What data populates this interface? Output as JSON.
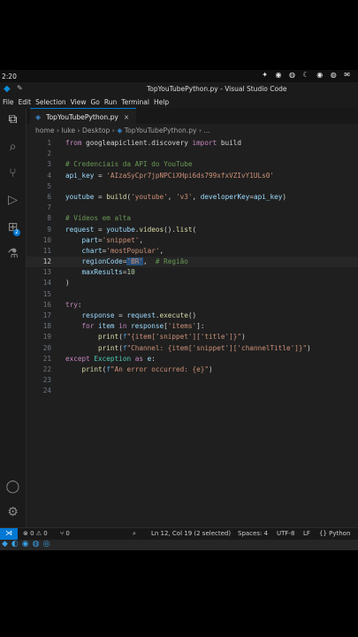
{
  "system": {
    "time": "2:20"
  },
  "window": {
    "title": "TopYouTubePython.py - Visual Studio Code"
  },
  "menu": [
    "File",
    "Edit",
    "Selection",
    "View",
    "Go",
    "Run",
    "Terminal",
    "Help"
  ],
  "tab": {
    "label": "TopYouTubePython.py",
    "close": "×"
  },
  "breadcrumb": [
    "home",
    "luke",
    "Desktop",
    "TopYouTubePython.py",
    "..."
  ],
  "code": [
    {
      "n": "1",
      "parts": [
        [
          "kw",
          "from"
        ],
        [
          "plain",
          " googleapiclient.discovery "
        ],
        [
          "kw",
          "import"
        ],
        [
          "plain",
          " build"
        ]
      ]
    },
    {
      "n": "2",
      "parts": []
    },
    {
      "n": "3",
      "parts": [
        [
          "cm",
          "# Credenciais da API do YouTube"
        ]
      ]
    },
    {
      "n": "4",
      "parts": [
        [
          "var",
          "api_key"
        ],
        [
          "plain",
          " = "
        ],
        [
          "str",
          "'AIzaSyCpr7jpNPCiXHpi6ds799xfxVZIvY1ULs0'"
        ]
      ]
    },
    {
      "n": "5",
      "parts": []
    },
    {
      "n": "6",
      "parts": [
        [
          "var",
          "youtube"
        ],
        [
          "plain",
          " = "
        ],
        [
          "fn",
          "build"
        ],
        [
          "plain",
          "("
        ],
        [
          "str",
          "'youtube'"
        ],
        [
          "plain",
          ", "
        ],
        [
          "str",
          "'v3'"
        ],
        [
          "plain",
          ", "
        ],
        [
          "var",
          "developerKey"
        ],
        [
          "plain",
          "="
        ],
        [
          "var",
          "api_key"
        ],
        [
          "plain",
          ")"
        ]
      ]
    },
    {
      "n": "7",
      "parts": []
    },
    {
      "n": "8",
      "parts": [
        [
          "cm",
          "# Vídeos em alta"
        ]
      ]
    },
    {
      "n": "9",
      "parts": [
        [
          "var",
          "request"
        ],
        [
          "plain",
          " = "
        ],
        [
          "var",
          "youtube"
        ],
        [
          "plain",
          "."
        ],
        [
          "fn",
          "videos"
        ],
        [
          "plain",
          "()."
        ],
        [
          "fn",
          "list"
        ],
        [
          "plain",
          "("
        ]
      ]
    },
    {
      "n": "10",
      "parts": [
        [
          "plain",
          "    "
        ],
        [
          "var",
          "part"
        ],
        [
          "plain",
          "="
        ],
        [
          "str",
          "'snippet'"
        ],
        [
          "plain",
          ","
        ]
      ]
    },
    {
      "n": "11",
      "parts": [
        [
          "plain",
          "    "
        ],
        [
          "var",
          "chart"
        ],
        [
          "plain",
          "="
        ],
        [
          "str",
          "'mostPopular'"
        ],
        [
          "plain",
          ","
        ]
      ]
    },
    {
      "n": "12",
      "parts": [
        [
          "plain",
          "    "
        ],
        [
          "var",
          "regionCode"
        ],
        [
          "plain",
          "="
        ],
        [
          "str",
          "'BR'"
        ],
        [
          "plain",
          ",  "
        ],
        [
          "cm",
          "# Região"
        ]
      ]
    },
    {
      "n": "13",
      "parts": [
        [
          "plain",
          "    "
        ],
        [
          "var",
          "maxResults"
        ],
        [
          "plain",
          "="
        ],
        [
          "num",
          "10"
        ]
      ]
    },
    {
      "n": "14",
      "parts": [
        [
          "plain",
          ")"
        ]
      ]
    },
    {
      "n": "15",
      "parts": []
    },
    {
      "n": "16",
      "parts": [
        [
          "kw",
          "try"
        ],
        [
          "plain",
          ":"
        ]
      ]
    },
    {
      "n": "17",
      "parts": [
        [
          "plain",
          "    "
        ],
        [
          "var",
          "response"
        ],
        [
          "plain",
          " = "
        ],
        [
          "var",
          "request"
        ],
        [
          "plain",
          "."
        ],
        [
          "fn",
          "execute"
        ],
        [
          "plain",
          "()"
        ]
      ]
    },
    {
      "n": "18",
      "parts": [
        [
          "plain",
          "    "
        ],
        [
          "kw",
          "for"
        ],
        [
          "plain",
          " "
        ],
        [
          "var",
          "item"
        ],
        [
          "plain",
          " "
        ],
        [
          "kw",
          "in"
        ],
        [
          "plain",
          " "
        ],
        [
          "var",
          "response"
        ],
        [
          "plain",
          "["
        ],
        [
          "str",
          "'items'"
        ],
        [
          "plain",
          "]:"
        ]
      ]
    },
    {
      "n": "19",
      "parts": [
        [
          "plain",
          "        "
        ],
        [
          "fn",
          "print"
        ],
        [
          "plain",
          "("
        ],
        [
          "kw2",
          "f"
        ],
        [
          "str",
          "\"{item['snippet']['title']}\""
        ],
        [
          "plain",
          ")"
        ]
      ]
    },
    {
      "n": "20",
      "parts": [
        [
          "plain",
          "        "
        ],
        [
          "fn",
          "print"
        ],
        [
          "plain",
          "("
        ],
        [
          "kw2",
          "f"
        ],
        [
          "str",
          "\"Channel: {item['snippet']['channelTitle']}\""
        ],
        [
          "plain",
          ")"
        ]
      ]
    },
    {
      "n": "21",
      "parts": [
        [
          "kw",
          "except"
        ],
        [
          "plain",
          " "
        ],
        [
          "cls",
          "Exception"
        ],
        [
          "plain",
          " "
        ],
        [
          "kw",
          "as"
        ],
        [
          "plain",
          " "
        ],
        [
          "var",
          "e"
        ],
        [
          "plain",
          ":"
        ]
      ]
    },
    {
      "n": "22",
      "parts": [
        [
          "plain",
          "    "
        ],
        [
          "fn",
          "print"
        ],
        [
          "plain",
          "("
        ],
        [
          "kw2",
          "f"
        ],
        [
          "str",
          "\"An error occurred: {e}\""
        ],
        [
          "plain",
          ")"
        ]
      ]
    },
    {
      "n": "23",
      "parts": []
    },
    {
      "n": "24",
      "parts": []
    }
  ],
  "status": {
    "problems": "⊗ 0 ⚠ 0",
    "ports": "⑂ 0",
    "position": "Ln 12, Col 19 (2 selected)",
    "spaces": "Spaces: 4",
    "encoding": "UTF-8",
    "eol": "LF",
    "language": "{} Python"
  },
  "colors": {
    "accent": "#0078d4",
    "editor_bg": "#1f1f1f",
    "activity_bg": "#1b1b1b"
  }
}
